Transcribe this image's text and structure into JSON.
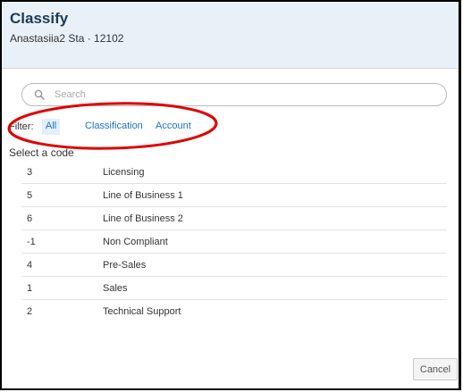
{
  "dialog": {
    "title": "Classify",
    "subtitle": "Anastasiia2 Sta · 12102"
  },
  "search": {
    "placeholder": "Search",
    "icon": "search-icon"
  },
  "filter": {
    "label": "Filter:",
    "options": [
      "All",
      "Classification",
      "Account"
    ],
    "selected": "All"
  },
  "annotation": {
    "color": "#e00000",
    "shape": "ellipse"
  },
  "codes": {
    "label": "Select a code",
    "items": [
      {
        "code": "3",
        "name": "Licensing"
      },
      {
        "code": "5",
        "name": "Line of Business 1"
      },
      {
        "code": "6",
        "name": "Line of Business 2"
      },
      {
        "code": "-1",
        "name": "Non Compliant"
      },
      {
        "code": "4",
        "name": "Pre-Sales"
      },
      {
        "code": "1",
        "name": "Sales"
      },
      {
        "code": "2",
        "name": "Technical Support"
      }
    ]
  },
  "footer": {
    "cancel_label": "Cancel"
  },
  "colors": {
    "header_bg": "#e8f1f8",
    "title": "#1e3a52",
    "link": "#1a73c4",
    "active_filter_bg": "#e3eef8"
  }
}
